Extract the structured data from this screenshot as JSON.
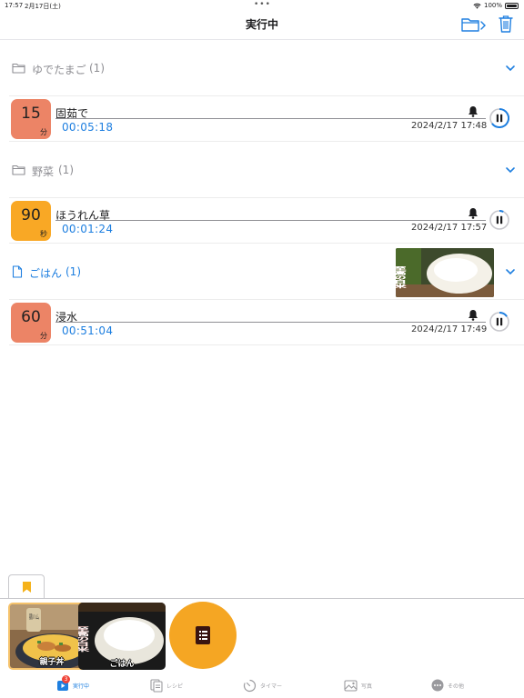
{
  "status_bar": {
    "time": "17:57",
    "date": "2月17日(土)",
    "battery": "100%"
  },
  "header": {
    "title": "実行中"
  },
  "groups": [
    {
      "label": "ゆでたまご",
      "count": "(1)",
      "icon": "folder-icon",
      "active": false
    },
    {
      "label": "野菜",
      "count": "(1)",
      "icon": "folder-icon",
      "active": false
    },
    {
      "label": "ごはん",
      "count": "(1)",
      "icon": "doc-icon",
      "active": true,
      "thumbnail_text": "至高の白米"
    }
  ],
  "timers": [
    {
      "duration": "15",
      "unit": "分",
      "color": "#ec8466",
      "name": "固茹で",
      "remaining": "00:05:18",
      "end_time": "2024/2/17 17:48",
      "progress": 0.65
    },
    {
      "duration": "90",
      "unit": "秒",
      "color": "#f9a825",
      "name": "ほうれん草",
      "remaining": "00:01:24",
      "end_time": "2024/2/17 17:57",
      "progress": 0.07
    },
    {
      "duration": "60",
      "unit": "分",
      "color": "#ec8466",
      "name": "浸水",
      "remaining": "00:51:04",
      "end_time": "2024/2/17 17:49",
      "progress": 0.15
    }
  ],
  "tray": {
    "items": [
      {
        "caption": "親子丼",
        "image_text": "鶏ハム"
      },
      {
        "caption": "ごはん",
        "image_text": "至高の白米"
      }
    ]
  },
  "tabs": [
    {
      "label": "実行中",
      "icon": "play-icon",
      "active": true,
      "badge": "3"
    },
    {
      "label": "レシピ",
      "icon": "recipe-icon",
      "active": false
    },
    {
      "label": "タイマー",
      "icon": "timer-icon",
      "active": false
    },
    {
      "label": "写真",
      "icon": "photo-icon",
      "active": false
    },
    {
      "label": "その他",
      "icon": "more-icon",
      "active": false
    }
  ],
  "colors": {
    "accent": "#1e7fe0",
    "orange": "#f5a623",
    "salmon": "#ec8466",
    "badge": "#f04438"
  }
}
